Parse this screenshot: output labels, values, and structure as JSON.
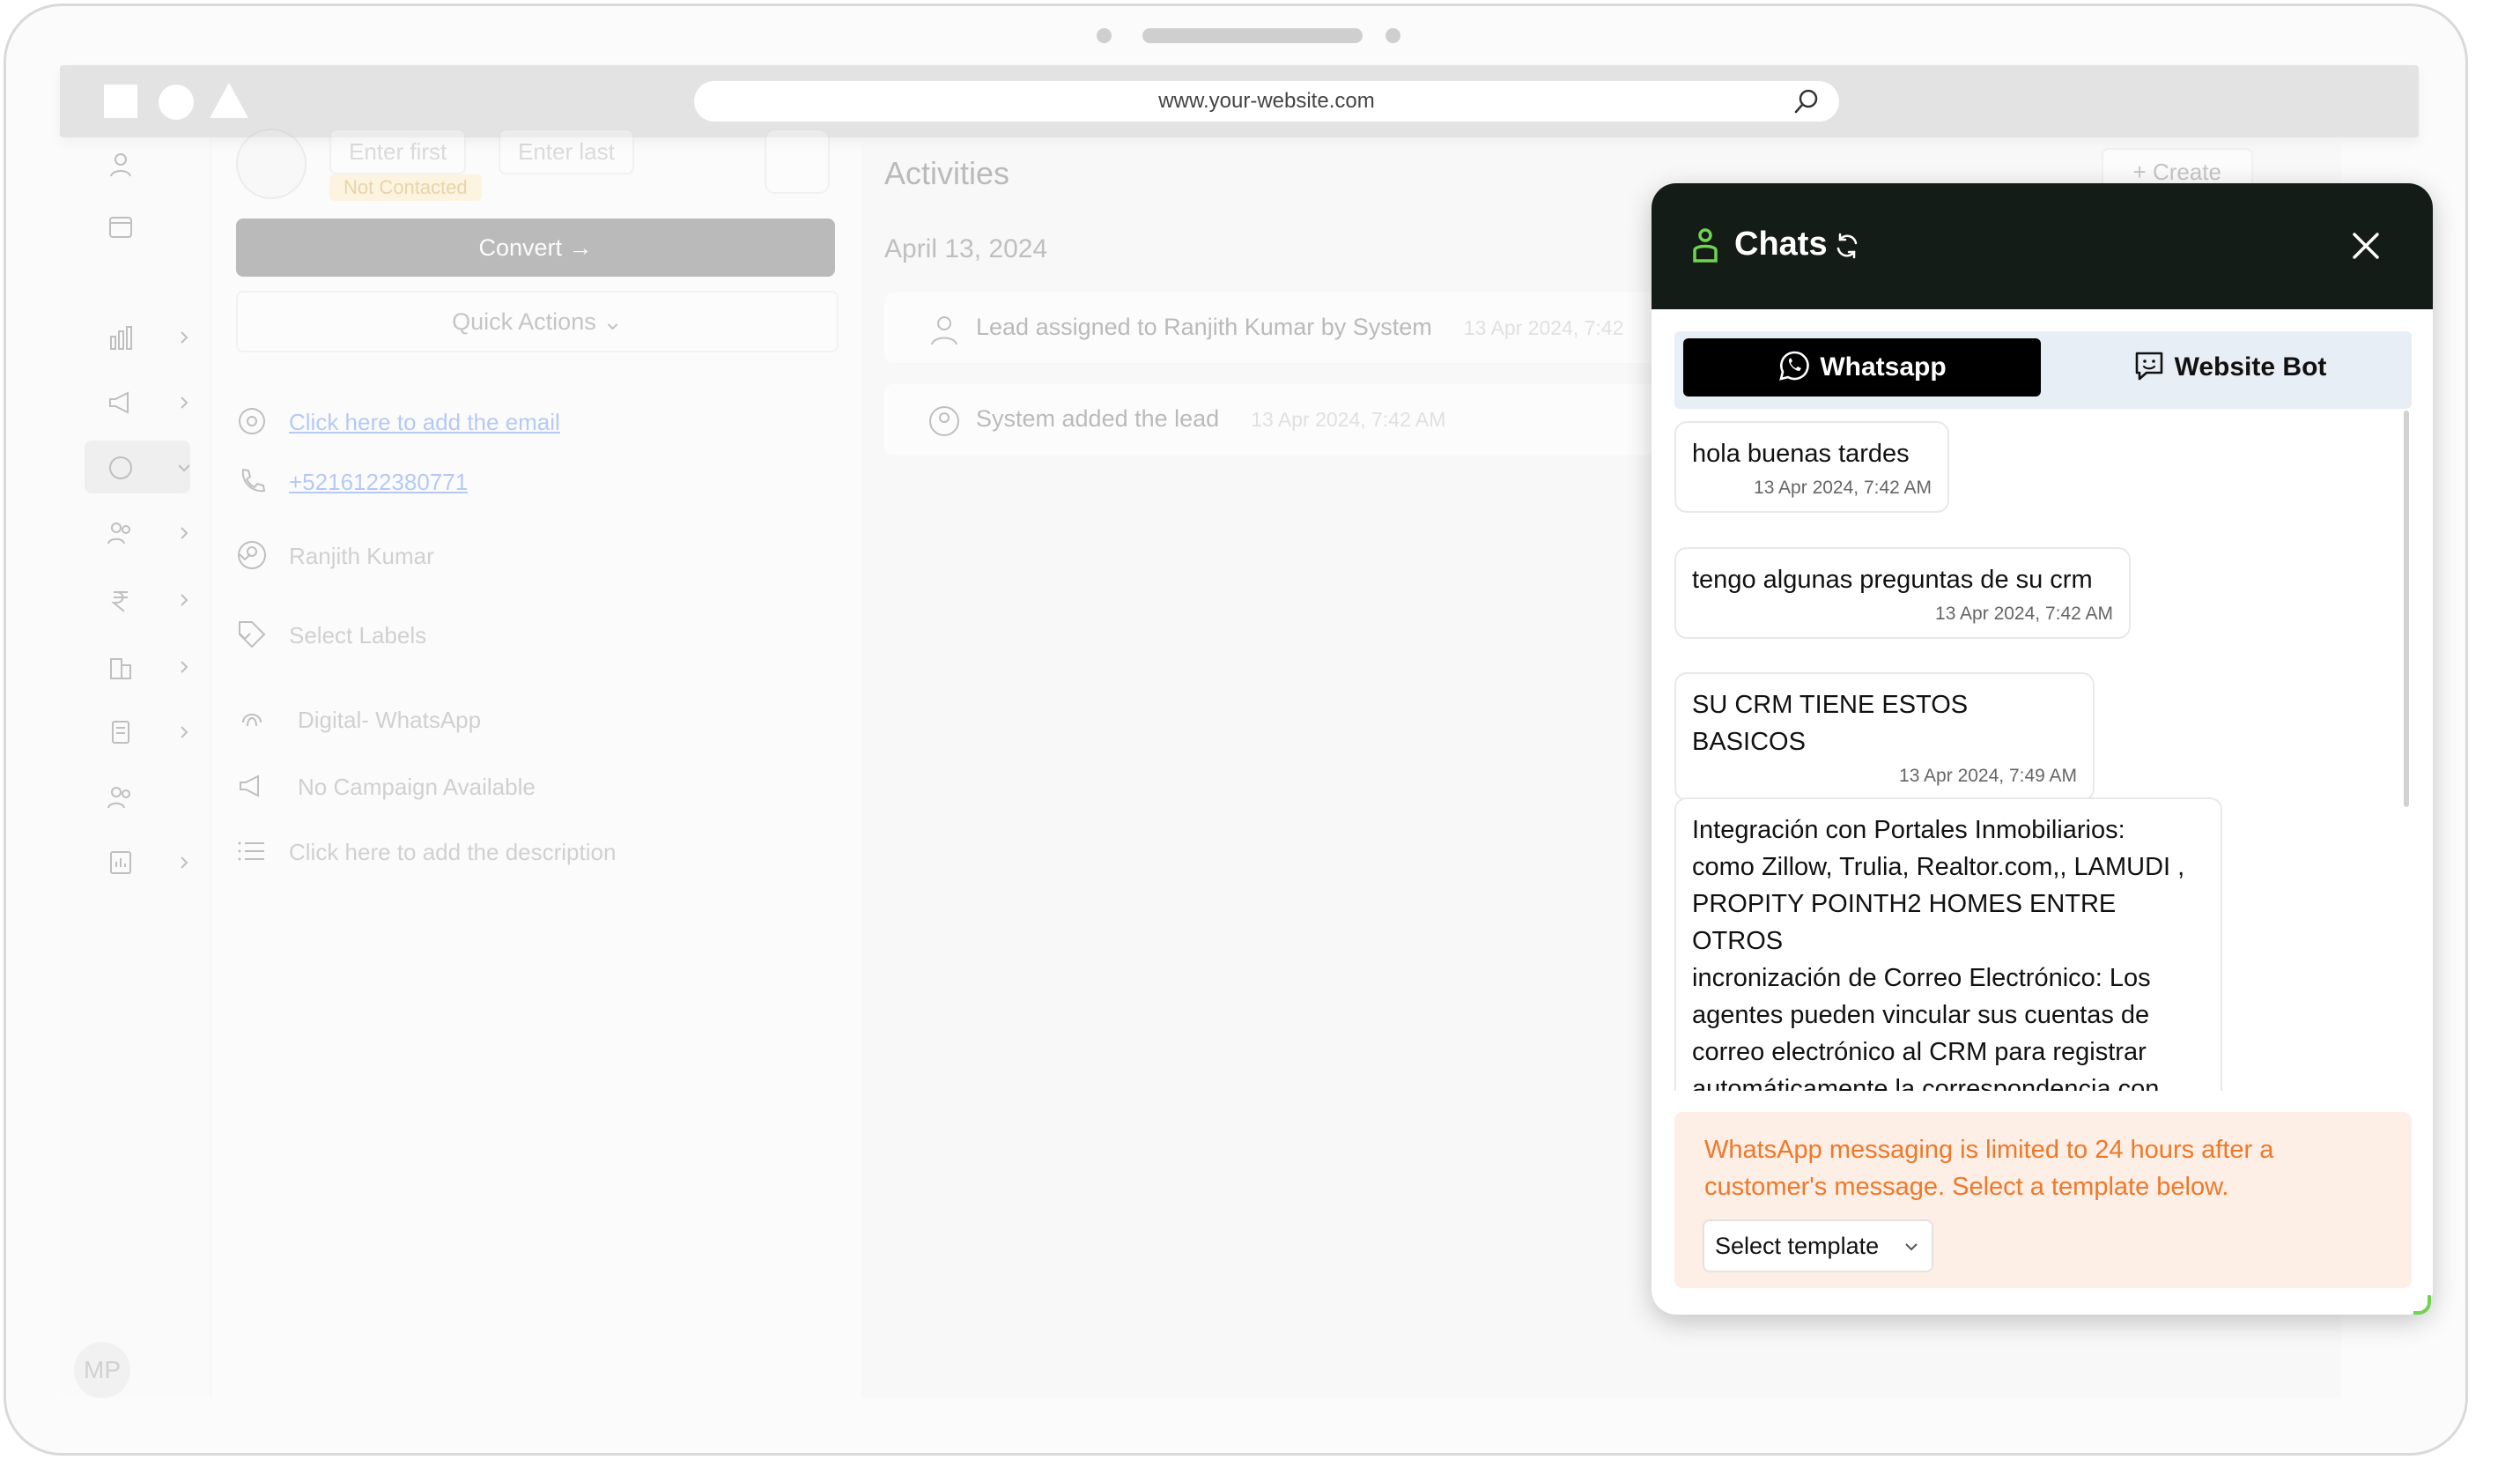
{
  "browser": {
    "url": "www.your-website.com"
  },
  "sidebar": {
    "avatar_initials": "MP"
  },
  "lead": {
    "first_name_placeholder": "Enter first",
    "last_name_placeholder": "Enter last",
    "status_badge": "Not Contacted",
    "convert_label": "Convert",
    "quick_actions_label": "Quick Actions",
    "email_link": "Click here to add the email",
    "phone": "+5216122380771",
    "assignee": "Ranjith Kumar",
    "labels_placeholder": "Select Labels",
    "source": "Digital- WhatsApp",
    "campaign": "No Campaign Available",
    "description_placeholder": "Click here to add the description"
  },
  "activities": {
    "title": "Activities",
    "create_label": "+ Create",
    "date_header": "April 13, 2024",
    "items": [
      {
        "text": "Lead assigned to Ranjith Kumar by System",
        "time": "13 Apr 2024, 7:42"
      },
      {
        "text": "System added the lead",
        "time": "13 Apr 2024, 7:42 AM"
      }
    ]
  },
  "chat": {
    "title": "Chats",
    "tabs": [
      {
        "label": "Whatsapp",
        "active": true
      },
      {
        "label": "Website Bot",
        "active": false
      }
    ],
    "messages": [
      {
        "text": "hola buenas tardes",
        "time": "13 Apr 2024, 7:42 AM"
      },
      {
        "text": "tengo algunas preguntas de su crm",
        "time": "13 Apr 2024, 7:42 AM"
      },
      {
        "text": "SU CRM TIENE ESTOS BASICOS",
        "time": "13 Apr 2024, 7:49 AM"
      },
      {
        "text": "Integración con Portales Inmobiliarios:\ncomo Zillow, Trulia, Realtor.com,, LAMUDI ,\nPROPITY POINTH2 HOMES  ENTRE\nOTROS\nincronización de Correo Electrónico: Los\nagentes pueden vincular sus cuentas de\ncorreo electrónico al CRM para registrar\nautomáticamente la correspondencia con",
        "time": ""
      }
    ],
    "notice": "WhatsApp messaging is limited to 24 hours after a customer's message. Select a template below.",
    "select_template_label": "Select template"
  },
  "colors": {
    "chat_header": "#131c16",
    "accent_green": "#6fd44f",
    "warning_text": "#f07828",
    "warning_bg": "#fdeee6"
  }
}
